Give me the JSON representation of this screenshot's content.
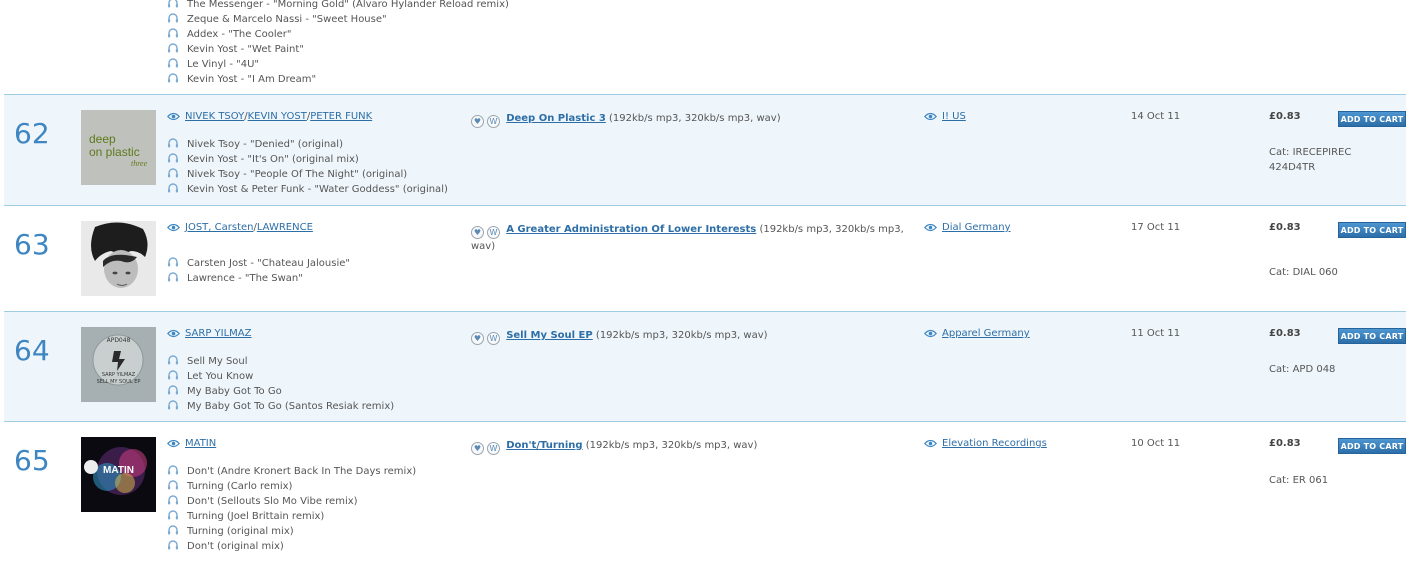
{
  "previous": {
    "tracks": [
      "The Messenger - \"Morning Gold\" (Alvaro Hylander Reload remix)",
      "Zeque & Marcelo Nassi - \"Sweet House\"",
      "Addex - \"The Cooler\"",
      "Kevin Yost - \"Wet Paint\"",
      "Le Vinyl - \"4U\"",
      "Kevin Yost - \"I Am Dream\""
    ]
  },
  "rows": [
    {
      "rank": "62",
      "cover": {
        "line1": "deep",
        "line2": "on plastic",
        "line3": "three"
      },
      "artists": [
        "NIVEK TSOY",
        "KEVIN YOST",
        "PETER FUNK"
      ],
      "tracks": [
        "Nivek Tsoy - \"Denied\" (original)",
        "Kevin Yost - \"It's On\" (original mix)",
        "Nivek Tsoy - \"People Of The Night\" (original)",
        "Kevin Yost & Peter Funk - \"Water Goddess\" (original)"
      ],
      "title": "Deep On Plastic 3",
      "formats": "(192kb/s mp3, 320kb/s mp3, wav)",
      "label": "I! US",
      "date": "14 Oct 11",
      "price": "£0.83",
      "cat": "Cat: IRECEPIREC 424D4TR",
      "cart": "ADD TO CART"
    },
    {
      "rank": "63",
      "artists": [
        "JOST, Carsten",
        "LAWRENCE"
      ],
      "tracks": [
        "Carsten Jost - \"Chateau Jalousie\"",
        "Lawrence - \"The Swan\""
      ],
      "title": "A Greater Administration Of Lower Interests",
      "formats": "(192kb/s mp3, 320kb/s mp3, wav)",
      "label": "Dial Germany",
      "date": "17 Oct 11",
      "price": "£0.83",
      "cat": "Cat: DIAL 060",
      "cart": "ADD TO CART"
    },
    {
      "rank": "64",
      "cover": {
        "line1": "APD048",
        "line2": "SARP YILMAZ",
        "line3": "SELL MY SOUL EP"
      },
      "artists": [
        "SARP YILMAZ"
      ],
      "tracks": [
        "Sell My Soul",
        "Let You Know",
        "My Baby Got To Go",
        "My Baby Got To Go (Santos Resiak remix)"
      ],
      "title": "Sell My Soul EP",
      "formats": "(192kb/s mp3, 320kb/s mp3, wav)",
      "label": "Apparel Germany",
      "date": "11 Oct 11",
      "price": "£0.83",
      "cat": "Cat: APD 048",
      "cart": "ADD TO CART"
    },
    {
      "rank": "65",
      "cover": {
        "line1": "MATIN"
      },
      "artists": [
        "MATIN"
      ],
      "tracks": [
        "Don't (Andre Kronert Back In The Days remix)",
        "Turning (Carlo remix)",
        "Don't (Sellouts Slo Mo Vibe remix)",
        "Turning (Joel Brittain remix)",
        "Turning (original mix)",
        "Don't (original mix)"
      ],
      "title": "Don't/Turning",
      "formats": "(192kb/s mp3, 320kb/s mp3, wav)",
      "label": "Elevation Recordings",
      "date": "10 Oct 11",
      "price": "£0.83",
      "cat": "Cat: ER 061",
      "cart": "ADD TO CART"
    }
  ],
  "icons": {
    "heart": "heart-icon",
    "wishlist": "w-icon",
    "preview": "eye-icon",
    "listen": "headphones-icon"
  },
  "colors": {
    "accent": "#3e86c2",
    "link": "#2d6ea6",
    "row_alt": "#eff6fb",
    "border": "#9fcbe3"
  }
}
